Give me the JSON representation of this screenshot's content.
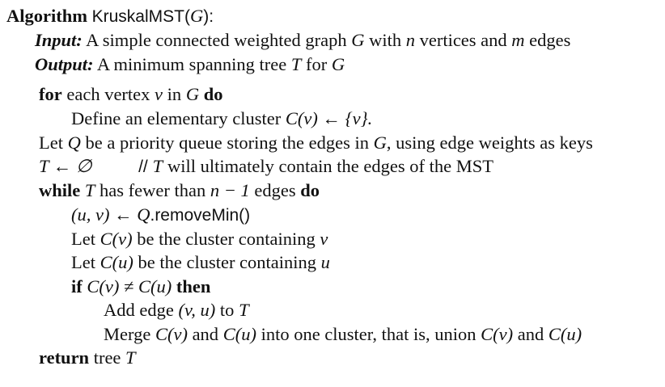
{
  "header": {
    "keyword": "Algorithm",
    "name": "KruskalMST",
    "param_open": "(",
    "param": "G",
    "param_close": "):"
  },
  "io": {
    "input_label": "Input:",
    "input_pre": "A simple connected weighted graph",
    "input_g": "G",
    "input_mid": "with",
    "input_n": "n",
    "input_mid2": "vertices and",
    "input_m": "m",
    "input_post": "edges",
    "output_label": "Output:",
    "output_pre": "A minimum spanning tree",
    "output_t": "T",
    "output_mid": "for",
    "output_g": "G"
  },
  "lines": {
    "l1_kw": "for",
    "l1_a": "each vertex",
    "l1_v": "v",
    "l1_b": "in",
    "l1_g": "G",
    "l1_do": "do",
    "l2_text": "Define an elementary cluster",
    "l2_math": "C(v) ← {v}.",
    "l3_a": "Let",
    "l3_q": "Q",
    "l3_b": "be a priority queue storing the edges in",
    "l3_g": "G",
    "l3_c": ", using edge weights as keys",
    "l4_math": "T ← ∅",
    "l4_comment_slash": "//",
    "l4_comment_t": "T",
    "l4_comment": "will ultimately contain the edges of the MST",
    "l5_kw": "while",
    "l5_t": "T",
    "l5_a": "has fewer than",
    "l5_expr": "n − 1",
    "l5_b": "edges",
    "l5_do": "do",
    "l6_pair": "(u, v) ←",
    "l6_q": "Q",
    "l6_method": ".removeMin()",
    "l7_a": "Let",
    "l7_c": "C(v)",
    "l7_b": "be the cluster containing",
    "l7_v": "v",
    "l8_a": "Let",
    "l8_c": "C(u)",
    "l8_b": "be the cluster containing",
    "l8_u": "u",
    "l9_kw": "if",
    "l9_cond": "C(v) ≠ C(u)",
    "l9_then": "then",
    "l10_a": "Add edge",
    "l10_pair": "(v, u)",
    "l10_b": "to",
    "l10_t": "T",
    "l11_a": "Merge",
    "l11_c1": "C(v)",
    "l11_b": "and",
    "l11_c2": "C(u)",
    "l11_c": "into one cluster, that is, union",
    "l11_c3": "C(v)",
    "l11_d": "and",
    "l11_c4": "C(u)",
    "l12_kw": "return",
    "l12_a": "tree",
    "l12_t": "T"
  }
}
